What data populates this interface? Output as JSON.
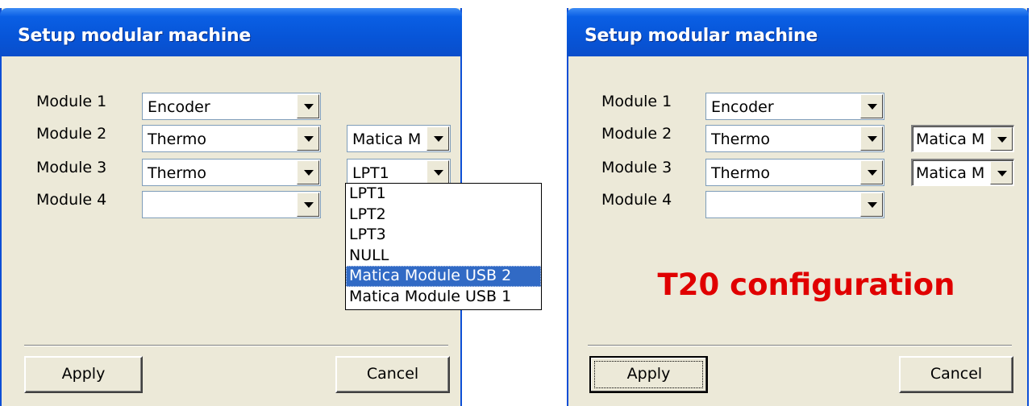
{
  "left_dialog": {
    "title": "Setup modular machine",
    "modules": [
      {
        "label": "Module 1",
        "value": "Encoder",
        "port": ""
      },
      {
        "label": "Module 2",
        "value": "Thermo",
        "port": "Matica M"
      },
      {
        "label": "Module 3",
        "value": "Thermo",
        "port": "LPT1"
      },
      {
        "label": "Module 4",
        "value": "",
        "port": ""
      }
    ],
    "port_dropdown": {
      "options": [
        "LPT1",
        "LPT2",
        "LPT3",
        "NULL",
        "Matica Module USB 2",
        "Matica Module USB 1"
      ],
      "highlighted": "Matica Module USB 2"
    },
    "apply_label": "Apply",
    "cancel_label": "Cancel"
  },
  "right_dialog": {
    "title": "Setup modular machine",
    "modules": [
      {
        "label": "Module 1",
        "value": "Encoder",
        "port": ""
      },
      {
        "label": "Module 2",
        "value": "Thermo",
        "port": "Matica M"
      },
      {
        "label": "Module 3",
        "value": "Thermo",
        "port": "Matica M"
      },
      {
        "label": "Module 4",
        "value": "",
        "port": ""
      }
    ],
    "apply_label": "Apply",
    "cancel_label": "Cancel",
    "caption": "T20 configuration"
  },
  "colors": {
    "title_bar": "#0755d8",
    "dialog_face": "#ece9d8",
    "selection": "#316ac5",
    "caption": "#e00000"
  }
}
